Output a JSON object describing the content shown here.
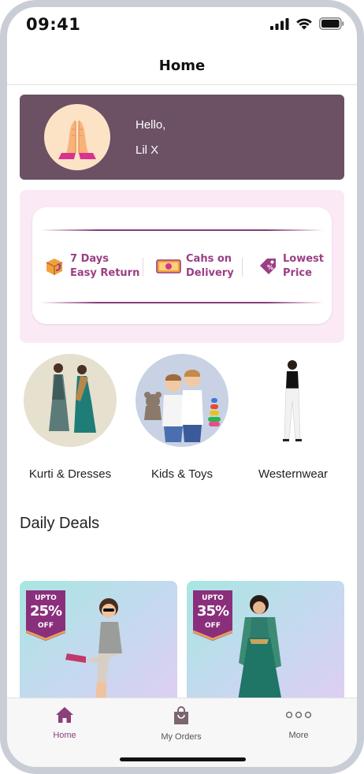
{
  "status_bar": {
    "time": "09:41"
  },
  "nav": {
    "title": "Home"
  },
  "greeting": {
    "hello": "Hello,",
    "name": "Lil X"
  },
  "benefits": [
    {
      "line1": "7 Days",
      "line2": "Easy Return",
      "icon": "box-return-icon"
    },
    {
      "line1": "Cahs on",
      "line2": "Delivery",
      "icon": "cash-icon"
    },
    {
      "line1": "Lowest",
      "line2": "Price",
      "icon": "price-tag-icon"
    }
  ],
  "categories": [
    {
      "label": "Kurti & Dresses"
    },
    {
      "label": "Kids & Toys"
    },
    {
      "label": "Westernwear"
    }
  ],
  "daily_deals": {
    "title": "Daily Deals",
    "items": [
      {
        "upto": "UPTO",
        "discount": "25%",
        "off": "OFF"
      },
      {
        "upto": "UPTO",
        "discount": "35%",
        "off": "OFF"
      }
    ]
  },
  "tabbar": {
    "items": [
      {
        "label": "Home",
        "icon": "home-icon",
        "active": true
      },
      {
        "label": "My Orders",
        "icon": "shopping-bag-icon",
        "active": false
      },
      {
        "label": "More",
        "icon": "more-dots-icon",
        "active": false
      }
    ]
  },
  "colors": {
    "accent": "#8c3f7a",
    "greeting_bg": "#6b5163",
    "benefits_bg": "#fbe9f5",
    "deal_badge": "#8a2f7c"
  }
}
